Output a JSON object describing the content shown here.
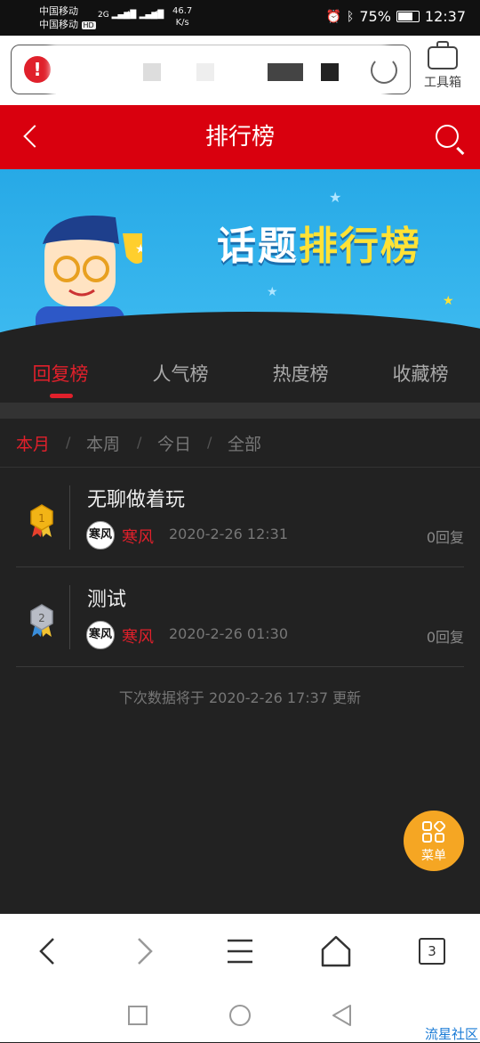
{
  "status_bar": {
    "carrier1": "中国移动",
    "carrier2": "中国移动",
    "hd_badge": "HD",
    "sig1": "2G",
    "sig2": "4G",
    "speed_value": "46.7",
    "speed_unit": "K/s",
    "battery": "75%",
    "time": "12:37"
  },
  "browser": {
    "toolbox_label": "工具箱"
  },
  "header": {
    "title": "排行榜"
  },
  "banner": {
    "text_white": "话题",
    "text_yellow": "排行榜"
  },
  "tabs": [
    {
      "label": "回复榜",
      "active": true
    },
    {
      "label": "人气榜",
      "active": false
    },
    {
      "label": "热度榜",
      "active": false
    },
    {
      "label": "收藏榜",
      "active": false
    }
  ],
  "filters": [
    {
      "label": "本月",
      "active": true
    },
    {
      "label": "本周",
      "active": false
    },
    {
      "label": "今日",
      "active": false
    },
    {
      "label": "全部",
      "active": false
    }
  ],
  "filter_separator": "/",
  "rankings": [
    {
      "rank": "1",
      "title": "无聊做着玩",
      "author": "寒风",
      "avatar_text": "寒风",
      "time": "2020-2-26 12:31",
      "replies": "0回复",
      "medal_color": "#f2b416"
    },
    {
      "rank": "2",
      "title": "测试",
      "author": "寒风",
      "avatar_text": "寒风",
      "time": "2020-2-26 01:30",
      "replies": "0回复",
      "medal_color": "#b8bcc6"
    }
  ],
  "next_update": "下次数据将于 2020-2-26 17:37 更新",
  "menu_button": {
    "label": "菜单",
    "color": "#f5a623"
  },
  "nav": {
    "tab_count": "3"
  },
  "watermark": "流星社区",
  "colors": {
    "accent": "#d9000e",
    "background": "#222222"
  }
}
